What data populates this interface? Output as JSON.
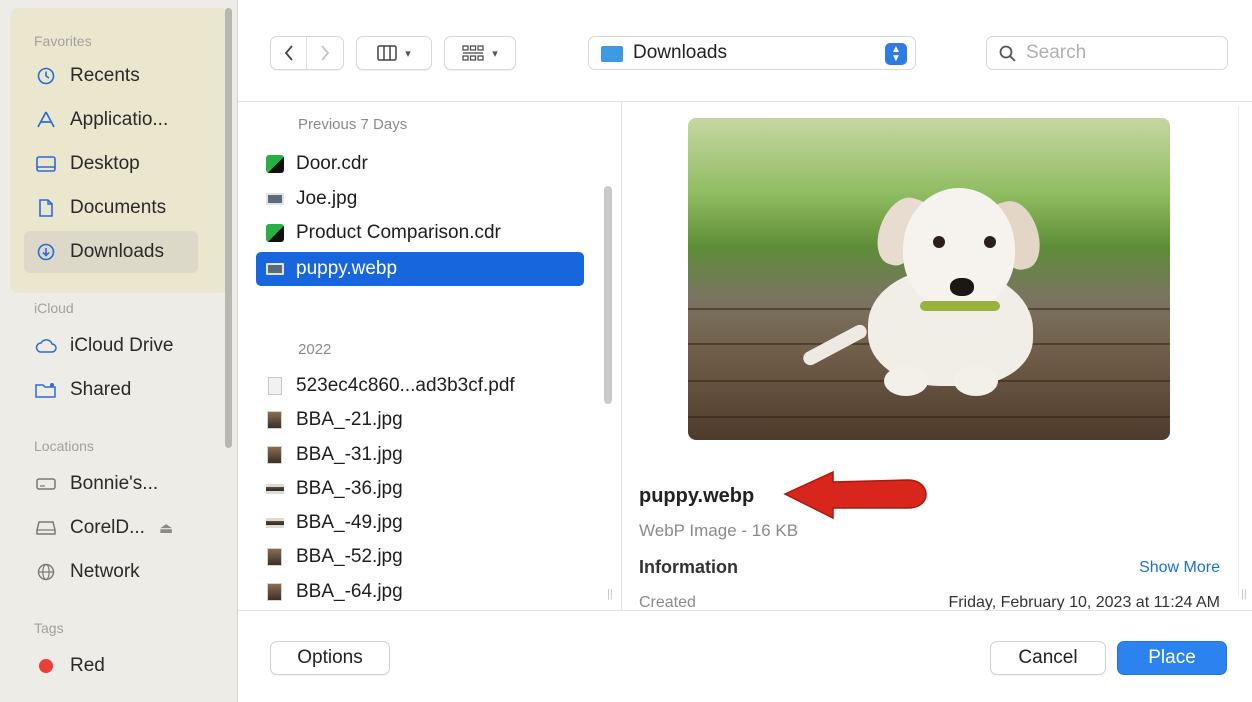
{
  "sidebar": {
    "favorites_heading": "Favorites",
    "favorites": [
      {
        "label": "Recents",
        "icon": "clock-icon"
      },
      {
        "label": "Applicatio...",
        "icon": "applications-icon"
      },
      {
        "label": "Desktop",
        "icon": "desktop-icon"
      },
      {
        "label": "Documents",
        "icon": "document-icon"
      },
      {
        "label": "Downloads",
        "icon": "download-icon",
        "selected": true
      }
    ],
    "icloud_heading": "iCloud",
    "icloud": [
      {
        "label": "iCloud Drive",
        "icon": "cloud-icon"
      },
      {
        "label": "Shared",
        "icon": "shared-folder-icon"
      }
    ],
    "locations_heading": "Locations",
    "locations": [
      {
        "label": "Bonnie's...",
        "icon": "computer-icon"
      },
      {
        "label": "CorelD...",
        "icon": "drive-icon",
        "eject": true
      },
      {
        "label": "Network",
        "icon": "globe-icon"
      }
    ],
    "tags_heading": "Tags",
    "tags": [
      {
        "label": "Red",
        "color": "#ec3f3b"
      }
    ]
  },
  "toolbar": {
    "location": "Downloads",
    "search_placeholder": "Search"
  },
  "browser": {
    "groups": [
      {
        "heading": "Previous 7 Days",
        "files": [
          {
            "name": "Door.cdr",
            "icon": "cdr-file-icon"
          },
          {
            "name": "Joe.jpg",
            "icon": "image-file-icon"
          },
          {
            "name": "Product Comparison.cdr",
            "icon": "cdr-file-icon"
          },
          {
            "name": "puppy.webp",
            "icon": "image-file-icon",
            "selected": true
          }
        ]
      },
      {
        "heading": "2022",
        "files": [
          {
            "name": "523ec4c860...ad3b3cf.pdf",
            "icon": "pdf-file-icon"
          },
          {
            "name": "BBA_-21.jpg",
            "icon": "photo-thumbnail-icon"
          },
          {
            "name": "BBA_-31.jpg",
            "icon": "photo-thumbnail-icon"
          },
          {
            "name": "BBA_-36.jpg",
            "icon": "wide-photo-thumbnail-icon"
          },
          {
            "name": "BBA_-49.jpg",
            "icon": "wide-photo-thumbnail-icon"
          },
          {
            "name": "BBA_-52.jpg",
            "icon": "photo-thumbnail-icon"
          },
          {
            "name": "BBA_-64.jpg",
            "icon": "photo-thumbnail-icon"
          }
        ]
      }
    ]
  },
  "preview": {
    "filename": "puppy.webp",
    "kind": "WebP Image - 16 KB",
    "info_heading": "Information",
    "show_more": "Show More",
    "created_label": "Created",
    "created_value": "Friday, February 10, 2023 at 11:24 AM"
  },
  "buttons": {
    "options": "Options",
    "cancel": "Cancel",
    "place": "Place"
  },
  "colors": {
    "accent": "#2c83f0",
    "selection": "#1766dd",
    "annotation_arrow": "#d9261c"
  }
}
